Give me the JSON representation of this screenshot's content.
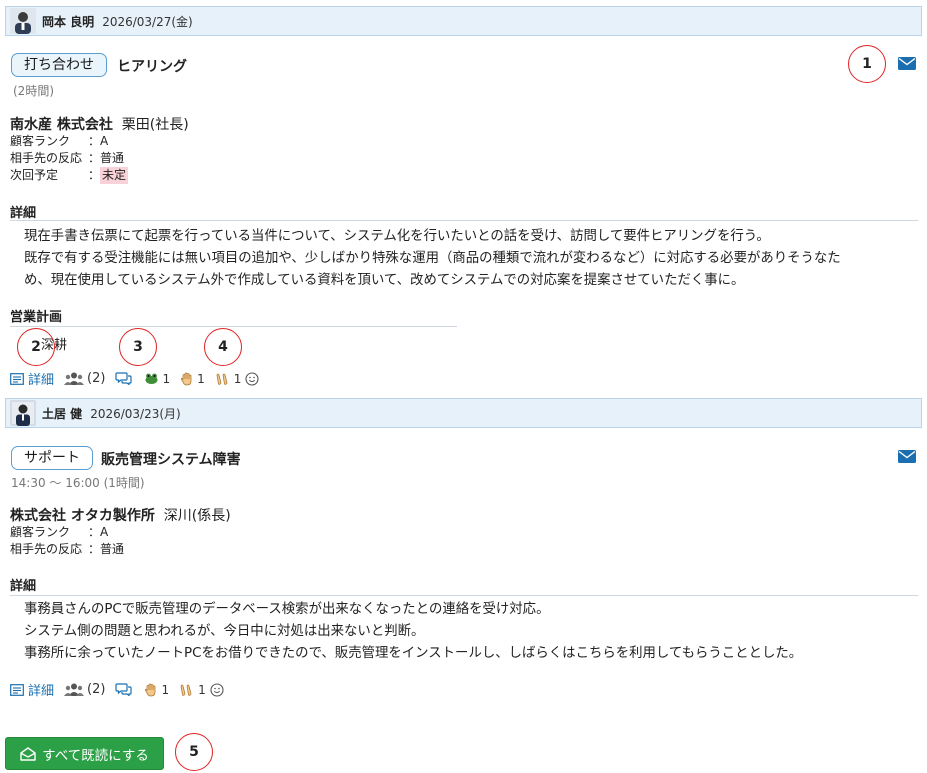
{
  "reports": [
    {
      "user": "岡本 良明",
      "date": "2026/03/27(金)",
      "category": "打ち合わせ",
      "title": "ヒアリング",
      "time": "(2時間)",
      "company": "南水産 株式会社",
      "person": "栗田(社長)",
      "fields": [
        {
          "key": "顧客ランク",
          "sep": "：",
          "value": "A"
        },
        {
          "key": "相手先の反応",
          "sep": "：",
          "value": "普通"
        },
        {
          "key": "次回予定",
          "sep": "：",
          "value": "未定"
        }
      ],
      "detail_heading": "詳細",
      "detail_lines": [
        "現在手書き伝票にて起票を行っている当件について、システム化を行いたいとの話を受け、訪問して要件ヒアリングを行う。",
        "既存で有する受注機能には無い項目の追加や、少しばかり特殊な運用（商品の種類で流れが変わるなど）に対応する必要がありそうなた",
        "め、現在使用しているシステム外で作成している資料を頂いて、改めてシステムでの対応案を提案させていただく事に。"
      ],
      "plan_heading": "営業計画",
      "plan_text": "深耕",
      "detail_link": "詳細",
      "participants": "(2)",
      "reaction_counts": [
        "1",
        "1",
        "1"
      ]
    },
    {
      "user": "土居 健",
      "date": "2026/03/23(月)",
      "category": "サポート",
      "title": "販売管理システム障害",
      "time": "14:30 ～ 16:00 (1時間)",
      "company": "株式会社 オタカ製作所",
      "person": "深川(係長)",
      "fields": [
        {
          "key": "顧客ランク",
          "sep": "：",
          "value": "A"
        },
        {
          "key": "相手先の反応",
          "sep": "：",
          "value": "普通"
        }
      ],
      "detail_heading": "詳細",
      "detail_lines": [
        "事務員さんのPCで販売管理のデータベース検索が出来なくなったとの連絡を受け対応。",
        "システム側の問題と思われるが、今日中に対処は出来ないと判断。",
        "事務所に余っていたノートPCをお借りできたので、販売管理をインストールし、しばらくはこちらを利用してもらうこととした。"
      ],
      "detail_link": "詳細",
      "participants": "(2)",
      "reaction_counts": [
        "1",
        "1"
      ]
    }
  ],
  "mark_all_read": "すべて既読にする",
  "markers": [
    "1",
    "2",
    "3",
    "4",
    "5"
  ],
  "colors": {
    "accent": "#1b6fb0",
    "header_bg": "#e7f1fa",
    "button_green": "#2ba046",
    "marker_red": "#e02424",
    "undecided_bg": "#f8d2d8"
  },
  "icons": [
    "avatar",
    "mail-icon",
    "detail-icon",
    "participants-icon",
    "comment-icon",
    "frog-icon",
    "hand-icon",
    "clap-icon",
    "smiley-icon",
    "envelope-open-icon"
  ]
}
